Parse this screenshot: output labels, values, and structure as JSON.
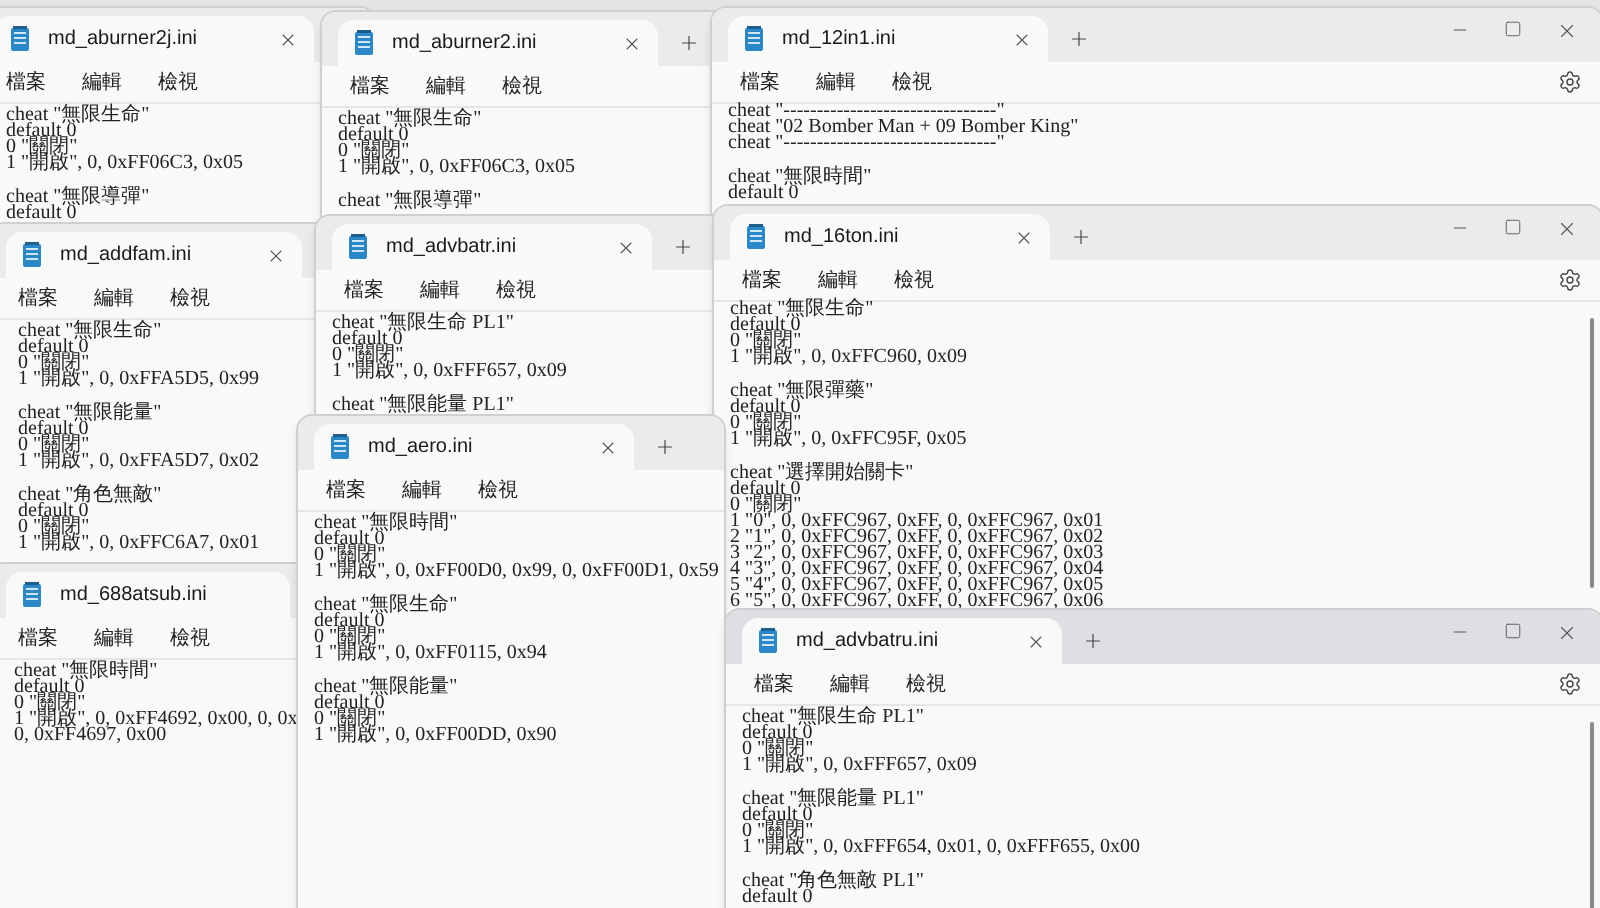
{
  "windows": [
    {
      "title": "md_aburner2j.ini",
      "active": false,
      "menu": [
        "檔案",
        "編輯",
        "檢視"
      ],
      "blocks": [
        [
          "cheat \"無限生命\"",
          "default 0",
          "0 \"關閉\"",
          "1 \"開啟\", 0, 0xFF06C3, 0x05"
        ],
        [
          "cheat \"無限導彈\"",
          "default 0"
        ]
      ]
    },
    {
      "title": "md_aburner2.ini",
      "active": false,
      "menu": [
        "檔案",
        "編輯",
        "檢視"
      ],
      "blocks": [
        [
          "cheat \"無限生命\"",
          "default 0",
          "0 \"關閉\"",
          "1 \"開啟\", 0, 0xFF06C3, 0x05"
        ],
        [
          "cheat \"無限導彈\""
        ]
      ]
    },
    {
      "title": "md_12in1.ini",
      "active": false,
      "menu": [
        "檔案",
        "編輯",
        "檢視"
      ],
      "blocks": [
        [
          "cheat \"--------------------------------\"",
          "cheat \"02 Bomber Man + 09 Bomber King\"",
          "cheat \"--------------------------------\""
        ],
        [
          "cheat \"無限時間\"",
          "default 0"
        ]
      ]
    },
    {
      "title": "md_addfam.ini",
      "active": false,
      "menu": [
        "檔案",
        "編輯",
        "檢視"
      ],
      "blocks": [
        [
          "cheat \"無限生命\"",
          "default 0",
          "0 \"關閉\"",
          "1 \"開啟\", 0, 0xFFA5D5, 0x99"
        ],
        [
          "cheat \"無限能量\"",
          "default 0",
          "0 \"關閉\"",
          "1 \"開啟\", 0, 0xFFA5D7, 0x02"
        ],
        [
          "cheat \"角色無敵\"",
          "default 0",
          "0 \"關閉\"",
          "1 \"開啟\", 0, 0xFFC6A7, 0x01"
        ]
      ]
    },
    {
      "title": "md_advbatr.ini",
      "active": false,
      "menu": [
        "檔案",
        "編輯",
        "檢視"
      ],
      "blocks": [
        [
          "cheat \"無限生命 PL1\"",
          "default 0",
          "0 \"關閉\"",
          "1 \"開啟\", 0, 0xFFF657, 0x09"
        ],
        [
          "cheat \"無限能量 PL1\""
        ]
      ]
    },
    {
      "title": "md_16ton.ini",
      "active": false,
      "menu": [
        "檔案",
        "編輯",
        "檢視"
      ],
      "blocks": [
        [
          "cheat \"無限生命\"",
          "default 0",
          "0 \"關閉\"",
          "1 \"開啟\", 0, 0xFFC960, 0x09"
        ],
        [
          "cheat \"無限彈藥\"",
          "default 0",
          "0 \"關閉\"",
          "1 \"開啟\", 0, 0xFFC95F, 0x05"
        ],
        [
          "cheat \"選擇開始關卡\"",
          "default 0",
          "0 \"關閉\"",
          "1 \"0\", 0, 0xFFC967, 0xFF, 0, 0xFFC967, 0x01",
          "2 \"1\", 0, 0xFFC967, 0xFF, 0, 0xFFC967, 0x02",
          "3 \"2\", 0, 0xFFC967, 0xFF, 0, 0xFFC967, 0x03",
          "4 \"3\", 0, 0xFFC967, 0xFF, 0, 0xFFC967, 0x04",
          "5 \"4\", 0, 0xFFC967, 0xFF, 0, 0xFFC967, 0x05",
          "6 \"5\", 0, 0xFFC967, 0xFF, 0, 0xFFC967, 0x06"
        ]
      ]
    },
    {
      "title": "md_688atsub.ini",
      "active": false,
      "menu": [
        "檔案",
        "編輯",
        "檢視"
      ],
      "blocks": [
        [
          "cheat \"無限時間\"",
          "default 0",
          "0 \"關閉\"",
          "1 \"開啟\", 0, 0xFF4692, 0x00, 0, 0x",
          "0, 0xFF4697, 0x00"
        ]
      ]
    },
    {
      "title": "md_aero.ini",
      "active": false,
      "menu": [
        "檔案",
        "編輯",
        "檢視"
      ],
      "blocks": [
        [
          "cheat \"無限時間\"",
          "default 0",
          "0 \"關閉\"",
          "1 \"開啟\", 0, 0xFF00D0, 0x99, 0, 0xFF00D1, 0x59"
        ],
        [
          "cheat \"無限生命\"",
          "default 0",
          "0 \"關閉\"",
          "1 \"開啟\", 0, 0xFF0115, 0x94"
        ],
        [
          "cheat \"無限能量\"",
          "default 0",
          "0 \"關閉\"",
          "1 \"開啟\", 0, 0xFF00DD, 0x90"
        ]
      ]
    },
    {
      "title": "md_advbatru.ini",
      "active": true,
      "menu": [
        "檔案",
        "編輯",
        "檢視"
      ],
      "blocks": [
        [
          "cheat \"無限生命 PL1\"",
          "default 0",
          "0 \"關閉\"",
          "1 \"開啟\", 0, 0xFFF657, 0x09"
        ],
        [
          "cheat \"無限能量 PL1\"",
          "default 0",
          "0 \"關閉\"",
          "1 \"開啟\", 0, 0xFFF654, 0x01, 0, 0xFFF655, 0x00"
        ],
        [
          "cheat \"角色無敵 PL1\"",
          "default 0"
        ]
      ]
    }
  ]
}
